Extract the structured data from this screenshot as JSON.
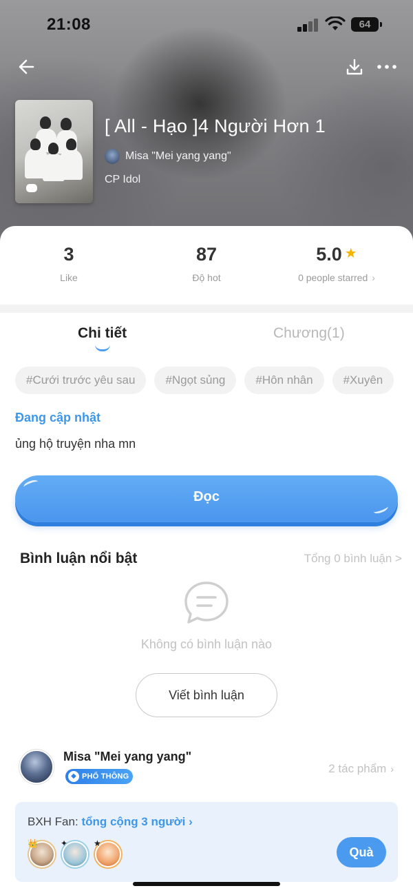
{
  "status_bar": {
    "time": "21:08",
    "battery": "64"
  },
  "story": {
    "title": "[ All - Hạo ]4 Người Hơn 1",
    "author": "Misa \"Mei yang yang\"",
    "category": "CP Idol"
  },
  "stats": [
    {
      "value": "3",
      "label": "Like"
    },
    {
      "value": "87",
      "label": "Độ hot"
    },
    {
      "value": "5.0",
      "label": "0 people starred"
    }
  ],
  "tabs": [
    {
      "label": "Chi tiết",
      "active": true
    },
    {
      "label": "Chương(1)",
      "active": false
    }
  ],
  "tags": [
    "#Cưới trước yêu sau",
    "#Ngọt sủng",
    "#Hôn nhân",
    "#Xuyên"
  ],
  "update_status": "Đang cập nhật",
  "description": "ủng hộ truyện nha mn",
  "read_button": "Đọc",
  "comments": {
    "title": "Bình luận nổi bật",
    "total": "Tổng 0 bình luận >",
    "empty": "Không có bình luận nào",
    "write_button": "Viết bình luận"
  },
  "author_card": {
    "name": "Misa \"Mei yang yang\"",
    "badge": "PHỔ THÔNG",
    "works": "2 tác phẩm"
  },
  "fan_ranking": {
    "label": "BXH Fan:",
    "count_text": "tổng cộng 3 người",
    "gift_button": "Quà"
  },
  "colors": {
    "accent": "#3d97ea",
    "button": "#4b96ee",
    "star": "#f5b400",
    "fan_box": "#e8f1fc"
  }
}
